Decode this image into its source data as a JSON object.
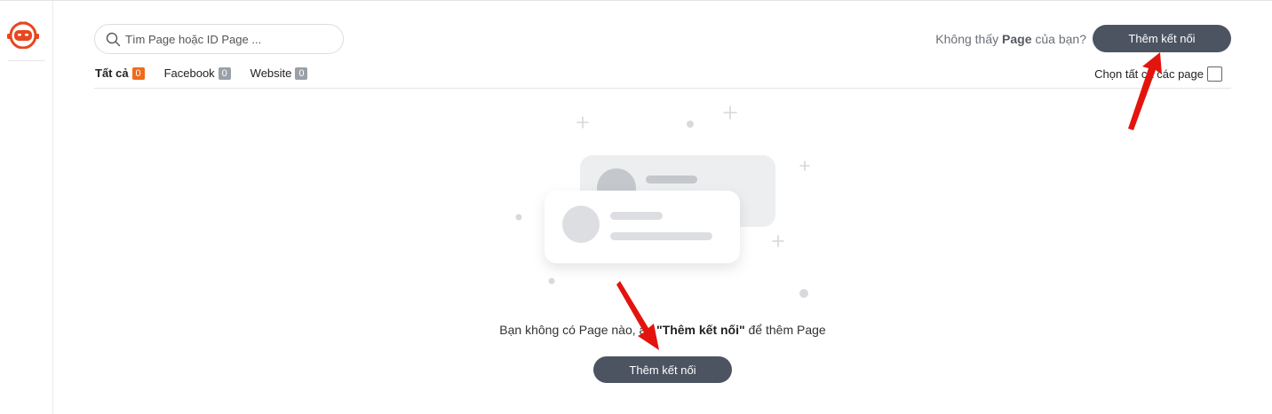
{
  "search": {
    "placeholder": "Tìm Page hoặc ID Page ..."
  },
  "header": {
    "hint_prefix": "Không thấy ",
    "hint_bold": "Page",
    "hint_suffix": " của bạn?",
    "connect_label": "Thêm kết nối"
  },
  "tabs": [
    {
      "label": "Tất cả",
      "count": "0"
    },
    {
      "label": "Facebook",
      "count": "0"
    },
    {
      "label": "Website",
      "count": "0"
    }
  ],
  "select_all_label": "Chọn tất cả các page",
  "empty_state": {
    "text_prefix": "Bạn không có Page nào, ấn ",
    "text_bold": "\"Thêm kết nối\"",
    "text_suffix": " để thêm Page",
    "button_label": "Thêm kết nối"
  },
  "colors": {
    "accent_dark": "#4c5361",
    "badge_orange": "#f06a1c",
    "arrow_red": "#e3140e"
  }
}
